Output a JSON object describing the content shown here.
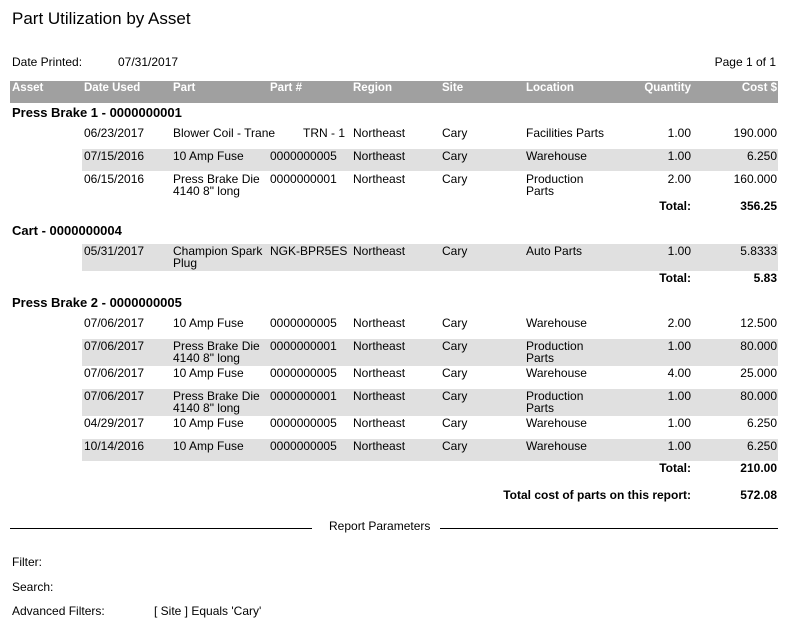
{
  "report": {
    "title": "Part Utilization by Asset",
    "date_printed_label": "Date Printed:",
    "date_printed": "07/31/2017",
    "page_label": "Page 1 of 1"
  },
  "columns": [
    "Asset",
    "Date Used",
    "Part",
    "Part #",
    "Region",
    "Site",
    "Location",
    "Quantity",
    "Cost $"
  ],
  "groups": [
    {
      "title": "Press Brake 1 - 0000000001",
      "rows": [
        {
          "date": "06/23/2017",
          "part": "Blower Coil - Trane",
          "part_no": "TRN - 1",
          "region": "Northeast",
          "site": "Cary",
          "location": "Facilities Parts",
          "qty": "1.00",
          "cost": "190.000"
        },
        {
          "date": "07/15/2016",
          "part": "10 Amp Fuse",
          "part_no": "0000000005",
          "region": "Northeast",
          "site": "Cary",
          "location": "Warehouse",
          "qty": "1.00",
          "cost": "6.250"
        },
        {
          "date": "06/15/2016",
          "part": "Press Brake Die 4140 8\" long",
          "part_no": "0000000001",
          "region": "Northeast",
          "site": "Cary",
          "location": "Production Parts",
          "qty": "2.00",
          "cost": "160.000"
        }
      ],
      "total_label": "Total:",
      "total": "356.25"
    },
    {
      "title": "Cart - 0000000004",
      "rows": [
        {
          "date": "05/31/2017",
          "part": "Champion Spark Plug",
          "part_no": "NGK-BPR5ES",
          "region": "Northeast",
          "site": "Cary",
          "location": "Auto Parts",
          "qty": "1.00",
          "cost": "5.8333"
        }
      ],
      "total_label": "Total:",
      "total": "5.83"
    },
    {
      "title": "Press Brake 2 - 0000000005",
      "rows": [
        {
          "date": "07/06/2017",
          "part": "10 Amp Fuse",
          "part_no": "0000000005",
          "region": "Northeast",
          "site": "Cary",
          "location": "Warehouse",
          "qty": "2.00",
          "cost": "12.500"
        },
        {
          "date": "07/06/2017",
          "part": "Press Brake Die 4140 8\" long",
          "part_no": "0000000001",
          "region": "Northeast",
          "site": "Cary",
          "location": "Production Parts",
          "qty": "1.00",
          "cost": "80.000"
        },
        {
          "date": "07/06/2017",
          "part": "10 Amp Fuse",
          "part_no": "0000000005",
          "region": "Northeast",
          "site": "Cary",
          "location": "Warehouse",
          "qty": "4.00",
          "cost": "25.000"
        },
        {
          "date": "07/06/2017",
          "part": "Press Brake Die 4140 8\" long",
          "part_no": "0000000001",
          "region": "Northeast",
          "site": "Cary",
          "location": "Production Parts",
          "qty": "1.00",
          "cost": "80.000"
        },
        {
          "date": "04/29/2017",
          "part": "10 Amp Fuse",
          "part_no": "0000000005",
          "region": "Northeast",
          "site": "Cary",
          "location": "Warehouse",
          "qty": "1.00",
          "cost": "6.250"
        },
        {
          "date": "10/14/2016",
          "part": "10 Amp Fuse",
          "part_no": "0000000005",
          "region": "Northeast",
          "site": "Cary",
          "location": "Warehouse",
          "qty": "1.00",
          "cost": "6.250"
        }
      ],
      "total_label": "Total:",
      "total": "210.00"
    }
  ],
  "grand_total_label": "Total cost of parts on this report:",
  "grand_total": "572.08",
  "parameters": {
    "heading": "Report Parameters",
    "filter_label": "Filter:",
    "search_label": "Search:",
    "advanced_label": "Advanced Filters:",
    "advanced_value": "[ Site ] Equals 'Cary'"
  }
}
